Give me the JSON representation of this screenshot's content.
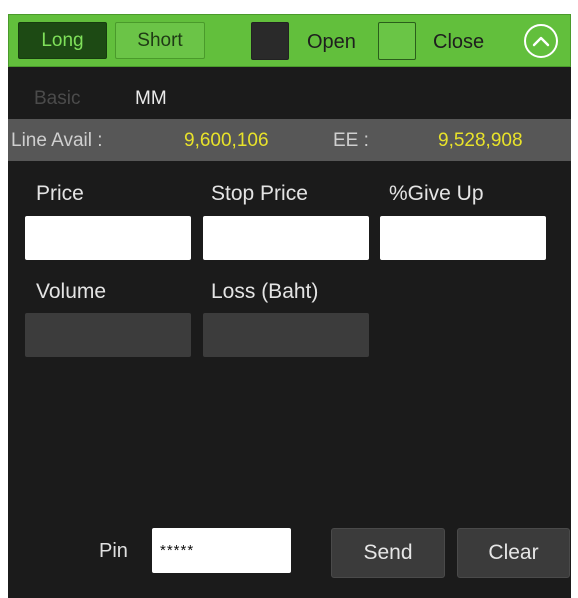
{
  "toolbar": {
    "long_label": "Long",
    "short_label": "Short",
    "open_label": "Open",
    "close_label": "Close",
    "collapse_icon": "chevron-up-circle-icon",
    "accent_color": "#62bf3c"
  },
  "tabs": [
    {
      "label": "Basic",
      "active": false
    },
    {
      "label": "MM",
      "active": true
    }
  ],
  "info": {
    "line_avail_label": "Line Avail :",
    "line_avail_value": "9,600,106",
    "ee_label": "EE :",
    "ee_value": "9,528,908",
    "value_color": "#e8e22a"
  },
  "form": {
    "price_label": "Price",
    "price_value": "",
    "stop_price_label": "Stop Price",
    "stop_price_value": "",
    "give_up_label": "%Give Up",
    "give_up_value": "",
    "volume_label": "Volume",
    "volume_value": "",
    "loss_label": "Loss (Baht)",
    "loss_value": ""
  },
  "footer": {
    "pin_label": "Pin",
    "pin_value": "*****",
    "send_label": "Send",
    "clear_label": "Clear"
  }
}
